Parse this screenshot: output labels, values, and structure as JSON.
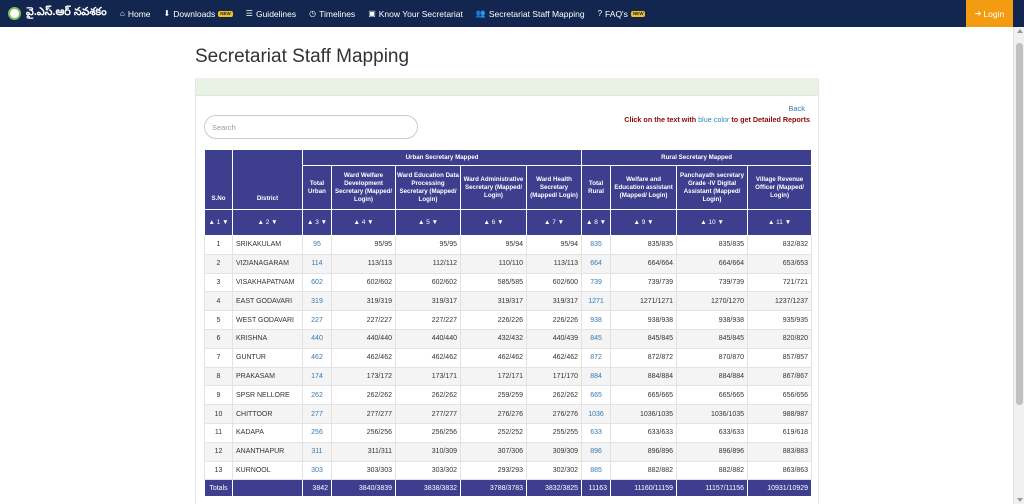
{
  "brand": {
    "name": "వై.ఎస్.ఆర్ నవశకం"
  },
  "nav": {
    "home": "Home",
    "downloads": "Downloads",
    "downloads_badge": "NEW",
    "guidelines": "Guidelines",
    "timelines": "Timelines",
    "know": "Know Your Secretariat",
    "staff": "Secretariat Staff Mapping",
    "faqs": "FAQ's",
    "faqs_badge": "NEW",
    "login": "Login"
  },
  "page": {
    "title": "Secretariat Staff Mapping",
    "back": "Back",
    "info_prefix": "Click on the text with",
    "info_blue": "blue color",
    "info_suffix": "to get Detailed Reports",
    "search_placeholder": "Search"
  },
  "colors": {
    "navbar": "#12264f",
    "header": "#3d3e8e",
    "accent": "#f39c12",
    "link": "#337ab7"
  },
  "table": {
    "group_urban": "Urban Secretary Mapped",
    "group_rural": "Rural Secretary Mapped",
    "headers": {
      "sno": "S.No",
      "district": "District",
      "total_urban": "Total Urban",
      "ward_welfare": "Ward Welfare Development Secretary (Mapped/ Login)",
      "ward_education": "Ward Education Data Processing Secretary (Mapped/ Login)",
      "ward_admin": "Ward Administrative Secretary (Mapped/ Login)",
      "ward_health": "Ward Health Secretary (Mapped/ Login)",
      "total_rural": "Total Rural",
      "welfare_edu": "Welfare and Education assistant (Mapped/ Login)",
      "panchayath": "Panchayath secretary Grade -IV Digital Assistant (Mapped/ Login)",
      "vro": "Village Revenue Officer (Mapped/ Login)"
    },
    "sort_labels": [
      "▲ 1 ▼",
      "▲ 2 ▼",
      "▲ 3 ▼",
      "▲ 4 ▼",
      "▲ 5 ▼",
      "▲ 6 ▼",
      "▲ 7 ▼",
      "▲ 8 ▼",
      "▲ 9 ▼",
      "▲ 10 ▼",
      "▲ 11 ▼"
    ],
    "rows": [
      [
        "1",
        "SRIKAKULAM",
        "95",
        "95/95",
        "95/95",
        "95/94",
        "95/94",
        "835",
        "835/835",
        "835/835",
        "832/832"
      ],
      [
        "2",
        "VIZIANAGARAM",
        "114",
        "113/113",
        "112/112",
        "110/110",
        "113/113",
        "664",
        "664/664",
        "664/664",
        "653/653"
      ],
      [
        "3",
        "VISAKHAPATNAM",
        "602",
        "602/602",
        "602/602",
        "585/585",
        "602/600",
        "739",
        "739/739",
        "739/739",
        "721/721"
      ],
      [
        "4",
        "EAST GODAVARI",
        "319",
        "319/319",
        "319/317",
        "319/317",
        "319/317",
        "1271",
        "1271/1271",
        "1270/1270",
        "1237/1237"
      ],
      [
        "5",
        "WEST GODAVARI",
        "227",
        "227/227",
        "227/227",
        "226/226",
        "226/226",
        "938",
        "938/938",
        "938/938",
        "935/935"
      ],
      [
        "6",
        "KRISHNA",
        "440",
        "440/440",
        "440/440",
        "432/432",
        "440/439",
        "845",
        "845/845",
        "845/845",
        "820/820"
      ],
      [
        "7",
        "GUNTUR",
        "462",
        "462/462",
        "462/462",
        "462/462",
        "462/462",
        "872",
        "872/872",
        "870/870",
        "857/857"
      ],
      [
        "8",
        "PRAKASAM",
        "174",
        "173/172",
        "173/171",
        "172/171",
        "171/170",
        "884",
        "884/884",
        "884/884",
        "867/867"
      ],
      [
        "9",
        "SPSR NELLORE",
        "262",
        "262/262",
        "262/262",
        "259/259",
        "262/262",
        "665",
        "665/665",
        "665/665",
        "656/656"
      ],
      [
        "10",
        "CHITTOOR",
        "277",
        "277/277",
        "277/277",
        "276/276",
        "276/276",
        "1036",
        "1036/1035",
        "1036/1035",
        "988/987"
      ],
      [
        "11",
        "KADAPA",
        "256",
        "256/256",
        "256/256",
        "252/252",
        "255/255",
        "633",
        "633/633",
        "633/633",
        "619/618"
      ],
      [
        "12",
        "ANANTHAPUR",
        "311",
        "311/311",
        "310/309",
        "307/306",
        "309/309",
        "896",
        "896/896",
        "896/896",
        "883/883"
      ],
      [
        "13",
        "KURNOOL",
        "303",
        "303/303",
        "303/302",
        "293/293",
        "302/302",
        "885",
        "882/882",
        "882/882",
        "863/863"
      ]
    ],
    "totals": [
      "Totals",
      "",
      "3842",
      "3840/3839",
      "3838/3832",
      "3788/3783",
      "3832/3825",
      "11163",
      "11160/11159",
      "11157/11156",
      "10931/10929"
    ]
  }
}
